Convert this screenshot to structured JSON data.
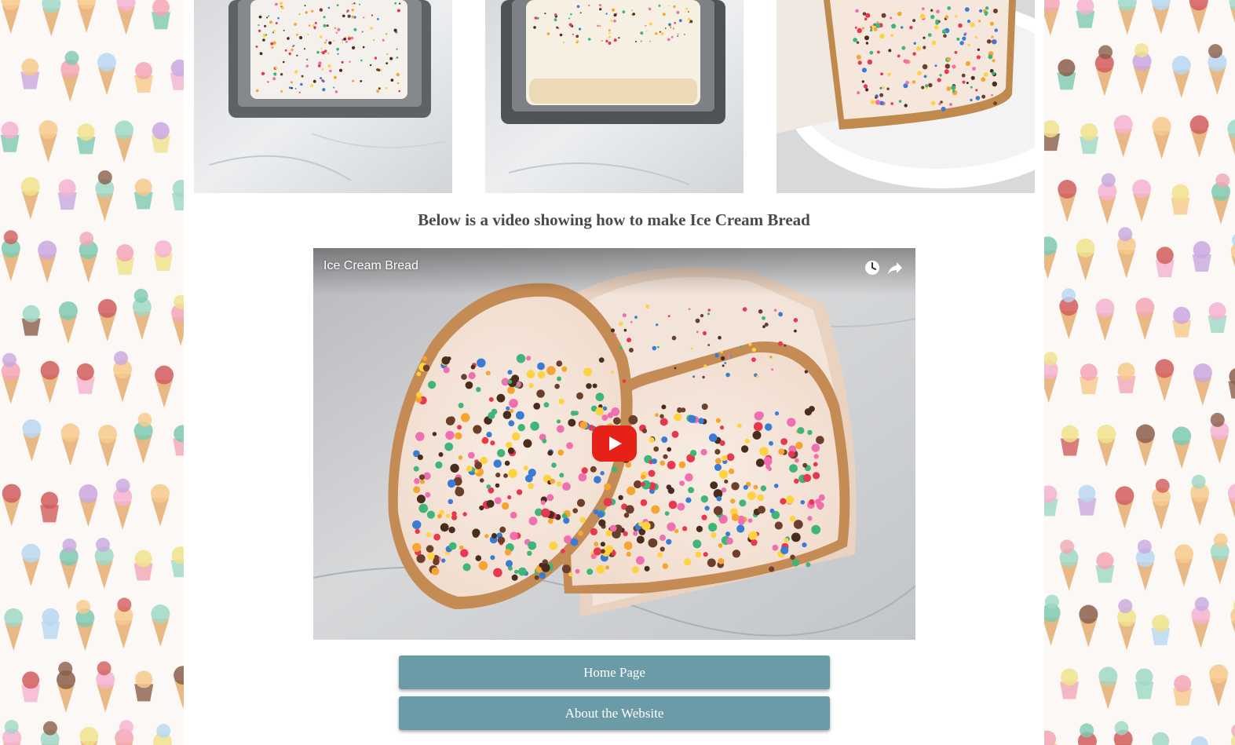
{
  "gallery": {
    "photos": [
      {
        "icon": "loaf-pan-unbaked-photo"
      },
      {
        "icon": "loaf-pan-baked-photo"
      },
      {
        "icon": "sliced-bread-plate-photo"
      }
    ]
  },
  "video_section": {
    "heading": "Below is a video showing how to make Ice Cream Bread",
    "player": {
      "title": "Ice Cream Bread",
      "watch_later_icon": "clock-icon",
      "share_icon": "share-arrow-icon",
      "play_icon": "youtube-play-icon",
      "play_color": "#e62117"
    }
  },
  "navigation": {
    "home_label": "Home Page",
    "about_label": "About the Website",
    "button_color": "#6b9ba6"
  },
  "wallpaper": {
    "theme": "ice-cream-cone-pattern"
  }
}
